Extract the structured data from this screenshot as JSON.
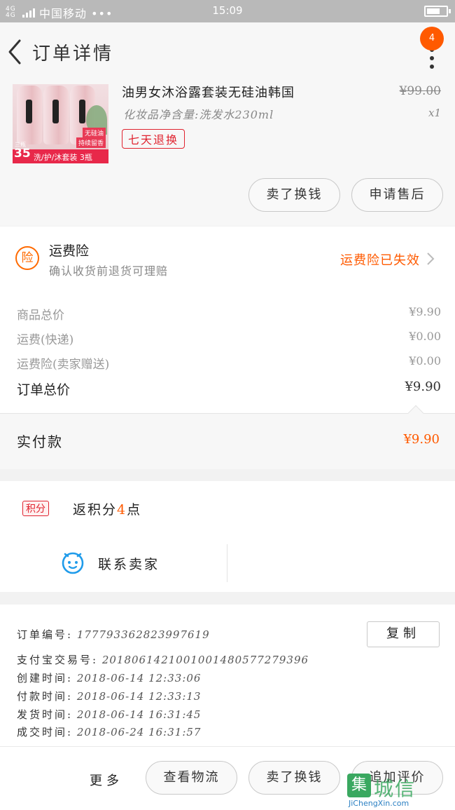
{
  "status_bar": {
    "network": "4G 4G",
    "carrier": "中国移动 •••",
    "time": "15:09"
  },
  "header": {
    "title": "订单详情",
    "badge": "4"
  },
  "product": {
    "name": "油男女沐浴露套装无硅油韩国",
    "spec": "化妆品净含量:洗发水230ml",
    "return_tag": "七天退换",
    "original_price": "¥99.00",
    "quantity": "x1",
    "thumb": {
      "tag1": "无硅油",
      "tag2": "持续留香",
      "three": "三瓶",
      "price": "35",
      "desc": "洗/护/沐套装 3瓶"
    }
  },
  "actions_top": {
    "sell_button": "卖了换钱",
    "after_sale_button": "申请售后"
  },
  "insurance": {
    "icon_text": "险",
    "title": "运费险",
    "subtitle": "确认收货前退货可理赔",
    "status": "运费险已失效"
  },
  "fees": [
    {
      "label": "商品总价",
      "value": "¥9.90"
    },
    {
      "label": "运费(快递)",
      "value": "¥0.00"
    },
    {
      "label": "运费险(卖家赠送)",
      "value": "¥0.00"
    }
  ],
  "order_total": {
    "label": "订单总价",
    "value": "¥9.90"
  },
  "paid": {
    "label": "实付款",
    "value": "¥9.90"
  },
  "points": {
    "badge": "积分",
    "text_prefix": "返积分",
    "number": "4",
    "text_suffix": "点",
    "contact": "联系卖家"
  },
  "order_info": {
    "copy_button": "复制",
    "rows": [
      {
        "label": "订单编号:",
        "value": "177793362823997619"
      },
      {
        "label": "支付宝交易号:",
        "value": "2018061421001001480577279396"
      },
      {
        "label": "创建时间:",
        "value": "2018-06-14 12:33:06"
      },
      {
        "label": "付款时间:",
        "value": "2018-06-14 12:33:13"
      },
      {
        "label": "发货时间:",
        "value": "2018-06-14 16:31:45"
      },
      {
        "label": "成交时间:",
        "value": "2018-06-24 16:31:57"
      }
    ]
  },
  "bottom_bar": {
    "more": "更多",
    "logistics": "查看物流",
    "sell": "卖了换钱",
    "review": "追加评价"
  },
  "watermark": {
    "mark": "集",
    "cn": "城信",
    "en": "JiChengXin.com"
  },
  "colors": {
    "accent": "#ff5a00",
    "red_tag": "#e0232f",
    "badge_bg": "#ff5a00"
  }
}
